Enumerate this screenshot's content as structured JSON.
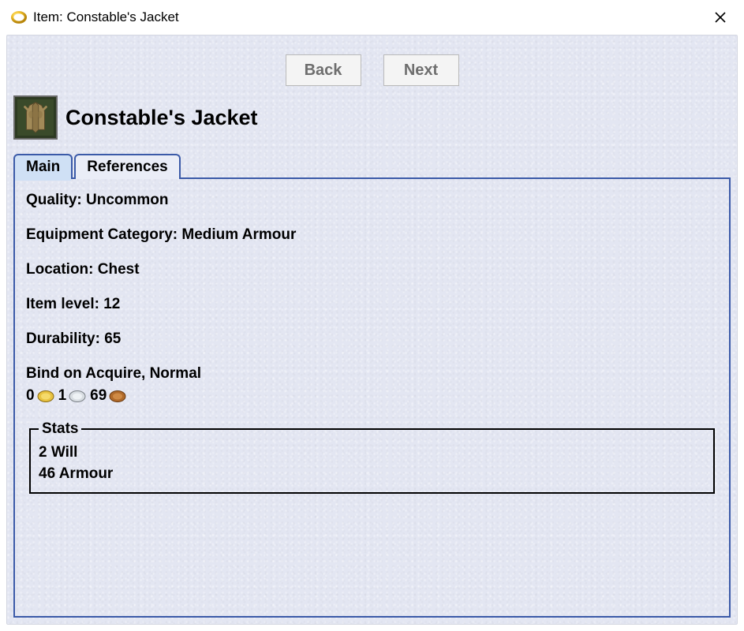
{
  "window": {
    "title": "Item: Constable's Jacket"
  },
  "nav": {
    "back_label": "Back",
    "next_label": "Next"
  },
  "item": {
    "name": "Constable's Jacket"
  },
  "tabs": {
    "main_label": "Main",
    "references_label": "References",
    "active": "main"
  },
  "main": {
    "quality_label": "Quality:",
    "quality_value": "Uncommon",
    "category_label": "Equipment Category:",
    "category_value": "Medium Armour",
    "location_label": "Location:",
    "location_value": "Chest",
    "item_level_label": "Item level:",
    "item_level_value": "12",
    "durability_label": "Durability:",
    "durability_value": "65",
    "binding_text": "Bind on Acquire, Normal",
    "price": {
      "gold": "0",
      "silver": "1",
      "copper": "69"
    },
    "stats": {
      "legend": "Stats",
      "lines": [
        "2 Will",
        "46 Armour"
      ]
    }
  }
}
